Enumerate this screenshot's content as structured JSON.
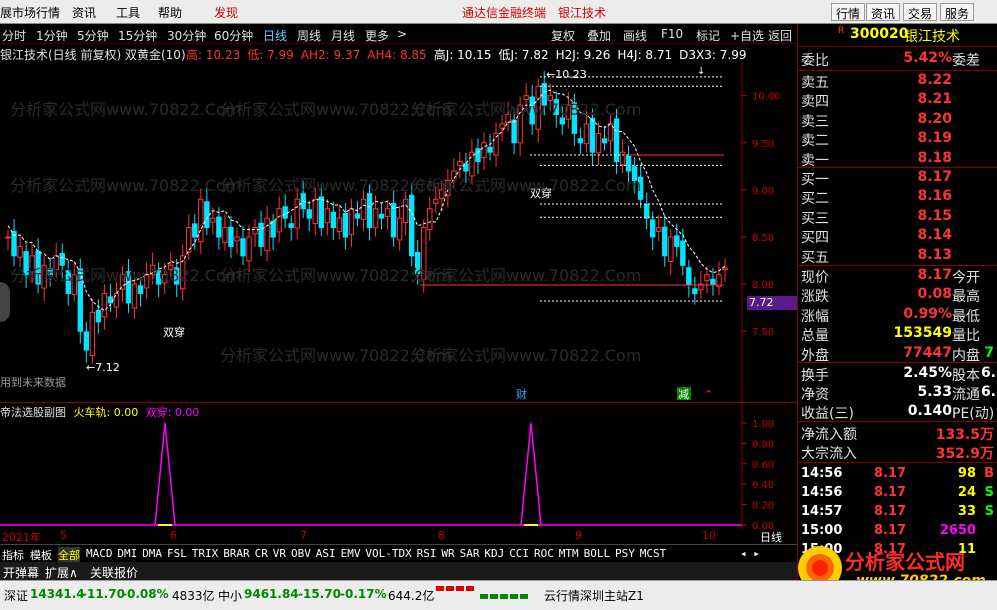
{
  "menubar": {
    "items": [
      "展市场行情",
      "资讯",
      "工具",
      "帮助"
    ],
    "highlight": "发现",
    "center_title": "通达信金融终端",
    "center_stock": "银江技术",
    "right_buttons": [
      "行情",
      "资讯",
      "交易",
      "服务"
    ]
  },
  "tabbar": {
    "periods": [
      "分时",
      "1分钟",
      "5分钟",
      "15分钟",
      "30分钟",
      "60分钟",
      "日线",
      "周线",
      "月线",
      "更多"
    ],
    "active": "日线",
    "more_arrow": ">",
    "tools": [
      "复权",
      "叠加",
      "画线",
      "F10",
      "标记",
      "+自选",
      "返回"
    ]
  },
  "info": {
    "title": "银江技术(日线 前复权) 双黄金(10)",
    "segments": [
      {
        "text": "高: 10.23",
        "color": "#ff3333"
      },
      {
        "text": "低: 7.99",
        "color": "#ff3333"
      },
      {
        "text": "AH2: 9.37",
        "color": "#ff3333"
      },
      {
        "text": "AH4: 8.85",
        "color": "#ff3333"
      },
      {
        "text": "高J: 10.15",
        "color": "#ffffff"
      },
      {
        "text": "低J: 7.82",
        "color": "#ffffff"
      },
      {
        "text": "H2J: 9.26",
        "color": "#ffffff"
      },
      {
        "text": "H4J: 8.71",
        "color": "#ffffff"
      },
      {
        "text": "D3X3: 7.99",
        "color": "#ffffff"
      }
    ]
  },
  "main_chart": {
    "y_ticks": [
      "10.00",
      "9.50",
      "9.00",
      "8.50",
      "8.00",
      "7.50"
    ],
    "current_price_tag": "7.72",
    "labels": {
      "high_mark": "10.23",
      "low_mark": "7.12",
      "cross1": "双穿",
      "cross2": "双穿",
      "future_note": "用到未来数据",
      "cai": "财",
      "jian": "减"
    },
    "watermark": "分析家公式网www.70822.Com"
  },
  "sub_chart": {
    "title": "帝法选股副图",
    "line1": "火车轨: 0.00",
    "line2": "双穿: 0.00",
    "y_ticks": [
      "1.00",
      "0.80",
      "0.60",
      "0.40",
      "0.20",
      "0.00"
    ]
  },
  "x_axis": {
    "labels": [
      "2021年",
      "5",
      "6",
      "7",
      "8",
      "9",
      "10"
    ],
    "period_label": "日线"
  },
  "indicator_tabs": [
    "指标",
    "模板",
    "全部",
    "MACD",
    "DMI",
    "DMA",
    "FSL",
    "TRIX",
    "BRAR",
    "CR",
    "VR",
    "OBV",
    "ASI",
    "EMV",
    "VOL-TDX",
    "RSI",
    "WR",
    "SAR",
    "KDJ",
    "CCI",
    "ROC",
    "MTM",
    "BOLL",
    "PSY",
    "MCST"
  ],
  "indicator_active": "全部",
  "bottom_tabs": [
    "开弹幕",
    "扩展∧",
    "关联报价"
  ],
  "quote": {
    "code": "300020",
    "name": "银江技术",
    "r_mark": "R",
    "weibi_label": "委比",
    "weibi_value": "5.42%",
    "weicha_label": "委差",
    "sells": [
      {
        "label": "卖五",
        "price": "8.22"
      },
      {
        "label": "卖四",
        "price": "8.21"
      },
      {
        "label": "卖三",
        "price": "8.20"
      },
      {
        "label": "卖二",
        "price": "8.19"
      },
      {
        "label": "卖一",
        "price": "8.18"
      }
    ],
    "buys": [
      {
        "label": "买一",
        "price": "8.17"
      },
      {
        "label": "买二",
        "price": "8.16"
      },
      {
        "label": "买三",
        "price": "8.15"
      },
      {
        "label": "买四",
        "price": "8.14"
      },
      {
        "label": "买五",
        "price": "8.13"
      }
    ],
    "stats": [
      {
        "label": "现价",
        "value": "8.17",
        "right": "今开",
        "cls": "up"
      },
      {
        "label": "涨跌",
        "value": "0.08",
        "right": "最高",
        "cls": "up"
      },
      {
        "label": "涨幅",
        "value": "0.99%",
        "right": "最低",
        "cls": "up"
      },
      {
        "label": "总量",
        "value": "153549",
        "right": "量比",
        "cls": "yl"
      },
      {
        "label": "外盘",
        "value": "77447",
        "right": "内盘",
        "cls": "up",
        "extra": "7"
      }
    ],
    "stats2": [
      {
        "label": "换手",
        "value": "2.45%",
        "right": "股本",
        "extra": "6."
      },
      {
        "label": "净资",
        "value": "5.33",
        "right": "流通",
        "extra": "6."
      },
      {
        "label": "收益(三)",
        "value": "0.140",
        "right": "PE(动)",
        "extra": ""
      }
    ],
    "flows": [
      {
        "label": "净流入额",
        "value": "133.5万"
      },
      {
        "label": "大宗流入",
        "value": "352.9万"
      }
    ],
    "ticks": [
      {
        "time": "14:56",
        "price": "8.17",
        "vol": "98",
        "flag": "B",
        "vcls": "yl",
        "fcls": "up"
      },
      {
        "time": "14:56",
        "price": "8.17",
        "vol": "24",
        "flag": "S",
        "vcls": "yl",
        "fcls": "gr"
      },
      {
        "time": "14:57",
        "price": "8.17",
        "vol": "33",
        "flag": "S",
        "vcls": "yl",
        "fcls": "gr"
      },
      {
        "time": "15:00",
        "price": "8.17",
        "vol": "2650",
        "flag": "",
        "vcls": "mg",
        "fcls": "up"
      },
      {
        "time": "15:00",
        "price": "8.17",
        "vol": "11",
        "flag": "",
        "vcls": "yl",
        "fcls": "up"
      }
    ]
  },
  "status": {
    "sz_label": "深证",
    "sz_val": "14341.4",
    "sz_chg": "-11.70",
    "sz_pct": "-0.08%",
    "sz_amt": "4833亿",
    "zx_label": "中小",
    "zx_val": "9461.84",
    "zx_chg": "-15.70",
    "zx_pct": "-0.17%",
    "zx_amt": "644.2亿",
    "server": "云行情深圳主站Z1"
  },
  "logo": {
    "title": "分析家公式网",
    "url": "www.70822.com"
  },
  "colors": {
    "up": "#ff3333",
    "down": "#00e5ff",
    "accent": "#ff0000"
  }
}
